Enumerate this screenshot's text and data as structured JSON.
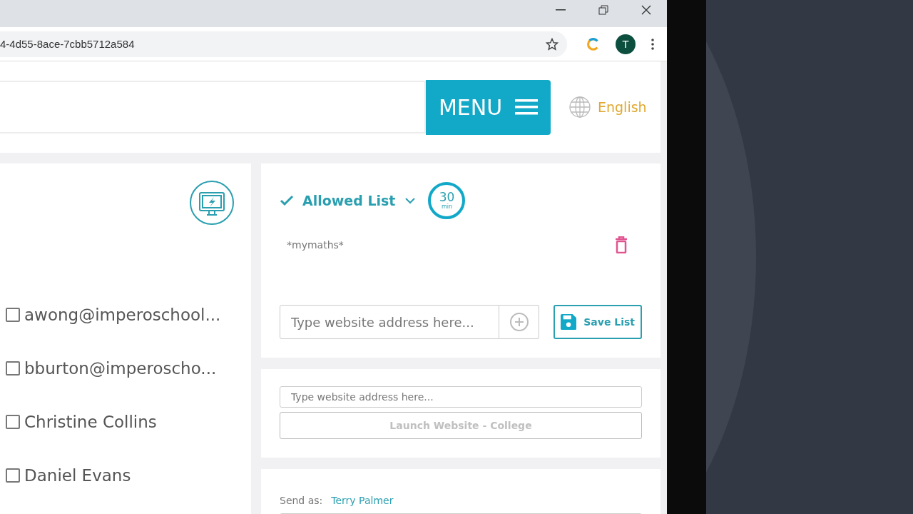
{
  "browser": {
    "url": "4-4d55-8ace-7cbb5712a584",
    "profile_initial": "T"
  },
  "header": {
    "menu_label": "MENU",
    "language": "English"
  },
  "students": [
    {
      "name": "awong@imperoschool...",
      "checked": false
    },
    {
      "name": "bburton@imperoscho...",
      "checked": false
    },
    {
      "name": "Christine Collins",
      "checked": false
    },
    {
      "name": "Daniel Evans",
      "checked": false
    }
  ],
  "allowed_list": {
    "title": "Allowed List",
    "timer_value": "30",
    "timer_unit": "min",
    "entries": [
      "*mymaths*"
    ],
    "input": {
      "placeholder": "Type website address here..."
    },
    "save_label": "Save List"
  },
  "launch": {
    "input": {
      "placeholder": "Type website address here..."
    },
    "button": {
      "label": "Launch Website - College",
      "disabled": true
    }
  },
  "send": {
    "label": "Send as:",
    "sender": "Terry Palmer"
  }
}
